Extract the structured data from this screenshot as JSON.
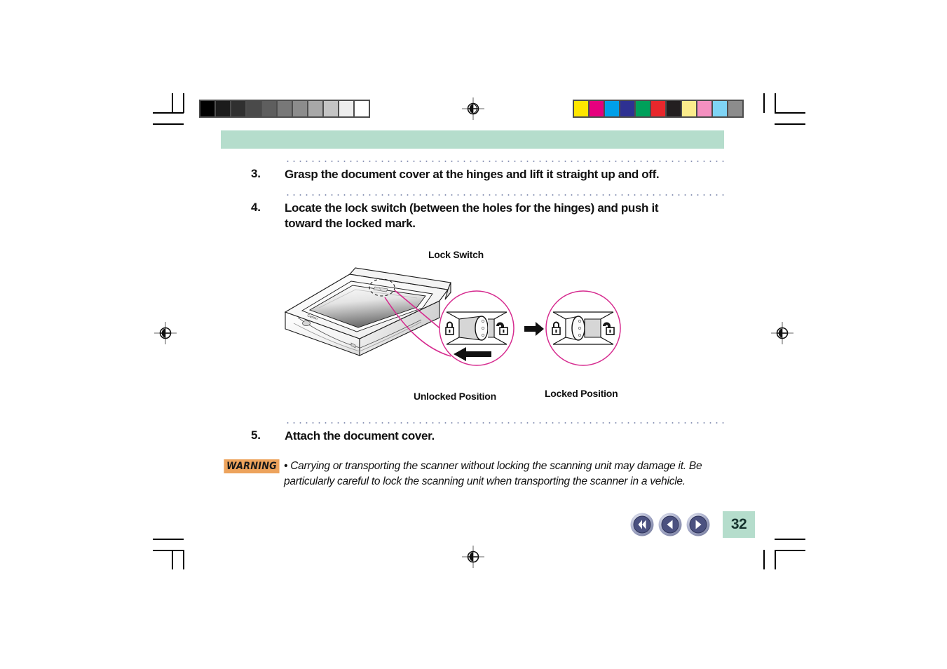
{
  "document": {
    "page_number": "32",
    "header_band_color": "#b5ddcc",
    "accent_magenta": "#d62b8f",
    "warning_badge_color": "#eda35c"
  },
  "steps": [
    {
      "number": "3.",
      "text": "Grasp the document cover at the hinges and lift it straight up and off."
    },
    {
      "number": "4.",
      "text": "Locate the lock switch (between the holes for the hinges) and push it\ntoward the locked mark."
    },
    {
      "number": "5.",
      "text": "Attach the document cover."
    }
  ],
  "figure": {
    "callout_label": "Lock Switch",
    "brand_mark": "Canon",
    "unlocked_label": "Unlocked Position",
    "locked_label": "Locked Position",
    "locked_icon_name": "padlock-closed-icon",
    "unlocked_icon_name": "padlock-open-icon",
    "direction_arrow_name": "arrow-left-icon",
    "transition_arrow_name": "arrow-right-icon"
  },
  "warning": {
    "badge_label": "WARNING",
    "bullet": "•",
    "text": "Carrying or transporting the scanner without locking the scanning unit may damage it. Be particularly careful to lock the scanning unit when transporting the scanner in a vehicle."
  },
  "navigation": {
    "first_label": "first-page",
    "prev_label": "previous-page",
    "next_label": "next-page",
    "page_label": "32"
  },
  "calibration": {
    "grayscale": [
      "#000000",
      "#1c1c1c",
      "#303030",
      "#4a4a4a",
      "#5e5e5e",
      "#787878",
      "#8c8c8c",
      "#a8a8a8",
      "#c4c4c4",
      "#ededed",
      "#ffffff"
    ],
    "colors": [
      "#ffe600",
      "#e6007e",
      "#00a0e9",
      "#2e3192",
      "#00a05a",
      "#e8272c",
      "#231f20",
      "#fbec8c",
      "#f490c0",
      "#7fd4f5",
      "#8c8c8c"
    ]
  }
}
